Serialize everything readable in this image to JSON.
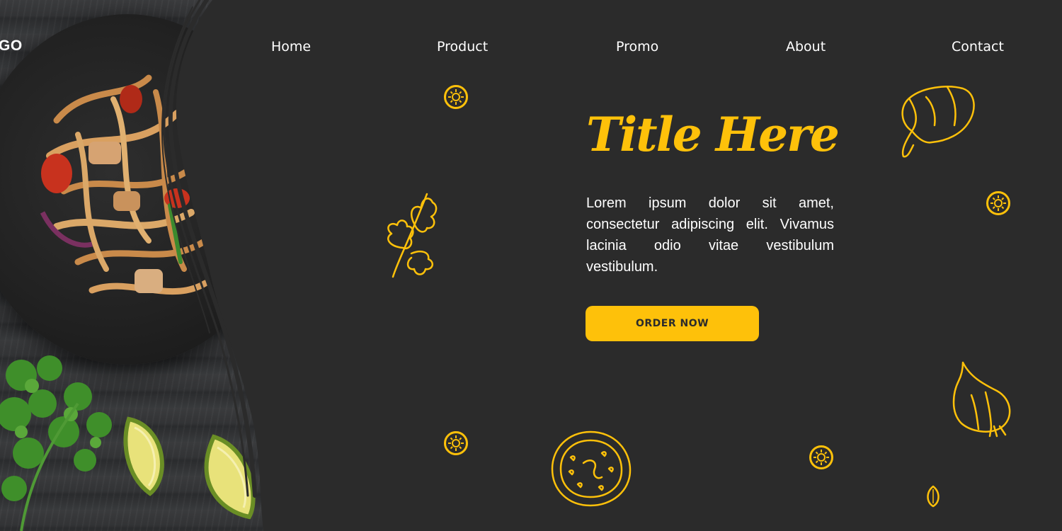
{
  "header": {
    "logo": "GO",
    "nav": [
      "Home",
      "Product",
      "Promo",
      "About",
      "Contact"
    ]
  },
  "hero": {
    "title": "Title Here",
    "body": "Lorem ipsum dolor sit amet, consectetur adipiscing elit. Vivamus lacinia odio vitae vestibulum vestibulum.",
    "cta_label": "ORDER NOW"
  },
  "colors": {
    "background": "#2b2b2b",
    "accent": "#fec10a",
    "text": "#ffffff"
  },
  "decorations": [
    "pan-of-noodles-photo",
    "cilantro-photo",
    "lime-wedge-photo",
    "lime-icon",
    "parsley-icon",
    "pepper-icon",
    "garlic-icon",
    "tomato-icon",
    "seed-icon"
  ]
}
